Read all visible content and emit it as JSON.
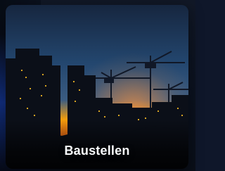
{
  "card": {
    "title": "Baustellen"
  },
  "colors": {
    "sky_top": "#1b2b44",
    "sky_mid": "#2a4f7a",
    "sunset": "#f97316",
    "sunset_glow": "#fb923c",
    "city_silhouette": "#0b0f18",
    "window_light": "#fbbf24",
    "text": "#f8fafc"
  },
  "icons": {
    "scene": "construction-cranes-city-skyline-at-dusk"
  }
}
